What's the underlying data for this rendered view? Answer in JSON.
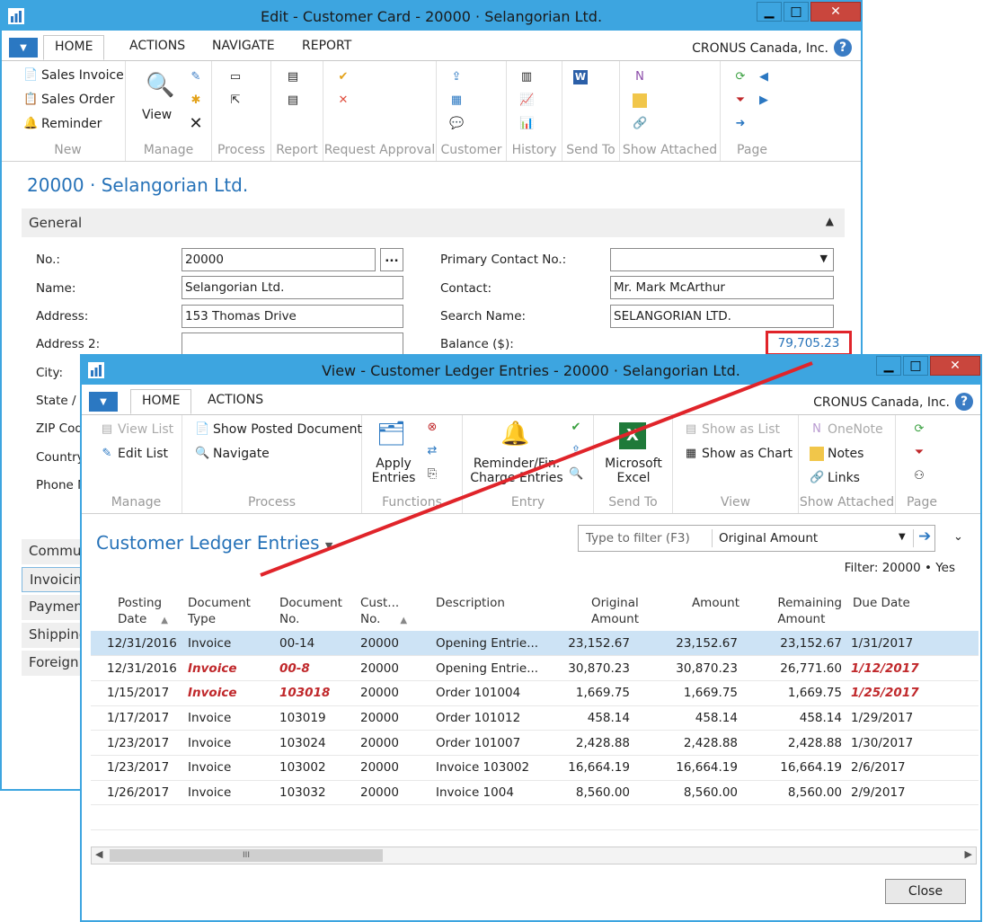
{
  "customer_card": {
    "title": "Edit - Customer Card - 20000 · Selangorian Ltd.",
    "tabs": [
      "HOME",
      "ACTIONS",
      "NAVIGATE",
      "REPORT"
    ],
    "company": "CRONUS Canada, Inc.",
    "ribbon": {
      "new_items": [
        "Sales Invoice",
        "Sales Order",
        "Reminder"
      ],
      "view_label": "View",
      "groups": [
        "New",
        "Manage",
        "Process",
        "Report",
        "Request Approval",
        "Customer",
        "History",
        "Send To",
        "Show Attached",
        "Page"
      ]
    },
    "page_title": "20000 · Selangorian Ltd.",
    "section_general": "General",
    "fields_left": [
      {
        "label": "No.:",
        "value": "20000"
      },
      {
        "label": "Name:",
        "value": "Selangorian Ltd."
      },
      {
        "label": "Address:",
        "value": "153 Thomas Drive"
      },
      {
        "label": "Address 2:",
        "value": ""
      },
      {
        "label": "City:"
      },
      {
        "label": "State / Z"
      },
      {
        "label": "ZIP Cod"
      },
      {
        "label": "Country"
      },
      {
        "label": "Phone N"
      }
    ],
    "fields_right": [
      {
        "label": "Primary Contact No.:",
        "value": ""
      },
      {
        "label": "Contact:",
        "value": "Mr. Mark McArthur"
      },
      {
        "label": "Search Name:",
        "value": "SELANGORIAN LTD."
      },
      {
        "label": "Balance ($):",
        "value": "79,705.23"
      }
    ],
    "lookup_btn": "...",
    "fasttabs": [
      "Commu",
      "Invoicin",
      "Paymen",
      "Shipping",
      "Foreign"
    ]
  },
  "ledger": {
    "title": "View - Customer Ledger Entries - 20000 · Selangorian Ltd.",
    "tabs": [
      "HOME",
      "ACTIONS"
    ],
    "company": "CRONUS Canada, Inc.",
    "ribbon": {
      "view_list": "View List",
      "edit_list": "Edit List",
      "show_posted": "Show Posted Document",
      "navigate": "Navigate",
      "apply_entries": "Apply\nEntries",
      "reminder": "Reminder/Fin.\nCharge Entries",
      "excel": "Microsoft\nExcel",
      "show_as_list": "Show as List",
      "show_as_chart": "Show as Chart",
      "onenote": "OneNote",
      "notes": "Notes",
      "links": "Links",
      "groups": [
        "Manage",
        "Process",
        "Functions",
        "Entry",
        "Send To",
        "View",
        "Show Attached",
        "Page"
      ]
    },
    "list_title": "Customer Ledger Entries",
    "filter_placeholder": "Type to filter (F3)",
    "filter_field": "Original Amount",
    "filter_text": "Filter: 20000 • Yes",
    "columns": [
      "Posting\nDate",
      "Document\nType",
      "Document\nNo.",
      "Cust...\nNo.",
      "Description",
      "Original\nAmount",
      "Amount",
      "Remaining\nAmount",
      "Due Date"
    ],
    "rows": [
      [
        "12/31/2016",
        "Invoice",
        "00-14",
        "20000",
        "Opening Entrie...",
        "23,152.67",
        "23,152.67",
        "23,152.67",
        "1/31/2017"
      ],
      [
        "12/31/2016",
        "Invoice",
        "00-8",
        "20000",
        "Opening Entrie...",
        "30,870.23",
        "30,870.23",
        "26,771.60",
        "1/12/2017"
      ],
      [
        "1/15/2017",
        "Invoice",
        "103018",
        "20000",
        "Order 101004",
        "1,669.75",
        "1,669.75",
        "1,669.75",
        "1/25/2017"
      ],
      [
        "1/17/2017",
        "Invoice",
        "103019",
        "20000",
        "Order 101012",
        "458.14",
        "458.14",
        "458.14",
        "1/29/2017"
      ],
      [
        "1/23/2017",
        "Invoice",
        "103024",
        "20000",
        "Order 101007",
        "2,428.88",
        "2,428.88",
        "2,428.88",
        "1/30/2017"
      ],
      [
        "1/23/2017",
        "Invoice",
        "103002",
        "20000",
        "Invoice 103002",
        "16,664.19",
        "16,664.19",
        "16,664.19",
        "2/6/2017"
      ],
      [
        "1/26/2017",
        "Invoice",
        "103032",
        "20000",
        "Invoice 1004",
        "8,560.00",
        "8,560.00",
        "8,560.00",
        "2/9/2017"
      ]
    ],
    "overdue_rows": [
      1,
      2
    ],
    "close_label": "Close",
    "scroll_grip": "III"
  },
  "colors": {
    "accent": "#3da5e0",
    "link": "#2672b8",
    "overdue": "#c0282b",
    "annotation": "#e0242a"
  }
}
